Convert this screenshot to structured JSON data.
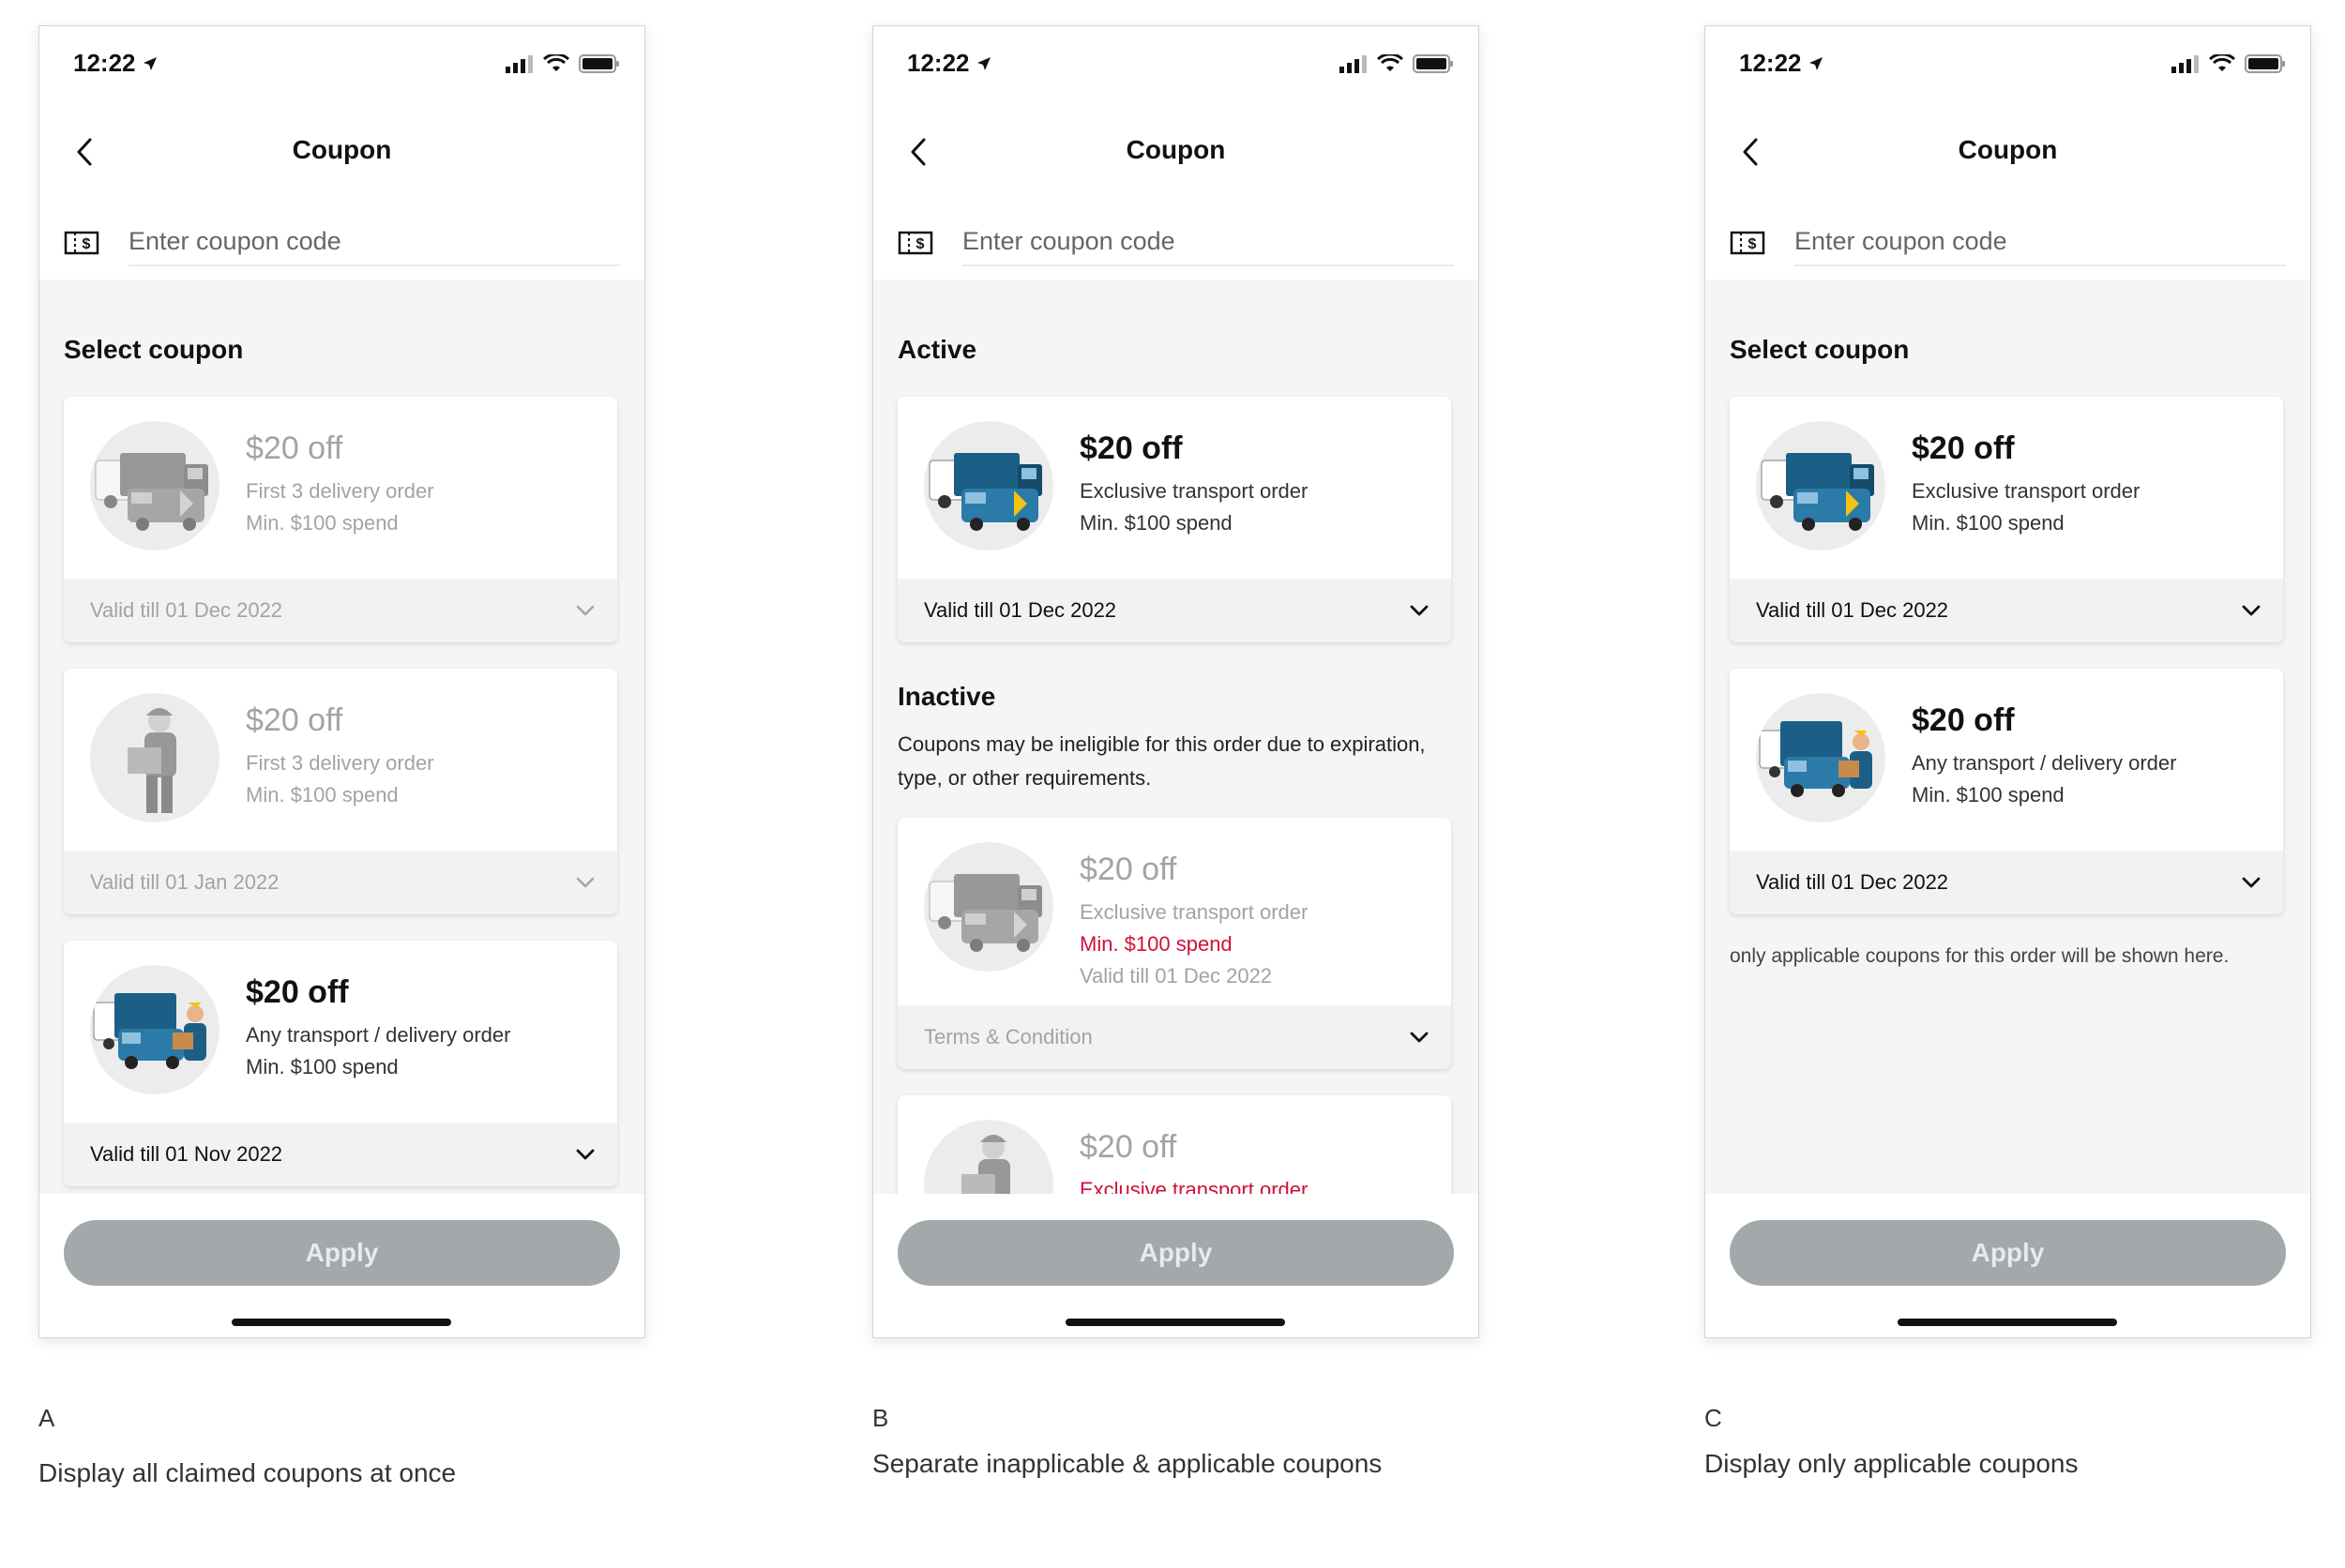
{
  "status": {
    "time": "12:22"
  },
  "common": {
    "screen_title": "Coupon",
    "coupon_placeholder": "Enter coupon code",
    "apply_label": "Apply"
  },
  "colors": {
    "apply_bg": "#a3a8ab",
    "accent_red": "#d0103a",
    "truck_blue": "#1c5f86",
    "highlight_yellow": "#f1c40f"
  },
  "variants": {
    "a": {
      "letter": "A",
      "caption": "Display all claimed coupons at once",
      "section_title": "Select coupon",
      "cards": [
        {
          "title": "$20 off",
          "line1": "First 3 delivery order",
          "line2": "Min. $100 spend",
          "footer": "Valid till 01 Dec 2022",
          "illustration": "truck-icon",
          "state": "inactive"
        },
        {
          "title": "$20 off",
          "line1": "First 3 delivery order",
          "line2": "Min. $100 spend",
          "footer": "Valid till 01 Jan 2022",
          "illustration": "courier-icon",
          "state": "inactive"
        },
        {
          "title": "$20 off",
          "line1": "Any transport / delivery order",
          "line2": "Min. $100 spend",
          "footer": "Valid till 01 Nov 2022",
          "illustration": "truck-courier-icon",
          "state": "active"
        }
      ]
    },
    "b": {
      "letter": "B",
      "caption": "Separate inapplicable & applicable coupons",
      "active_title": "Active",
      "inactive_title": "Inactive",
      "inactive_desc": "Coupons may be ineligible for this order due to expiration, type, or other requirements.",
      "cards": [
        {
          "title": "$20 off",
          "line1": "Exclusive transport order",
          "line2": "Min. $100 spend",
          "footer": "Valid till 01 Dec 2022",
          "illustration": "truck-icon",
          "state": "active"
        },
        {
          "title": "$20 off",
          "line1": "Exclusive transport order",
          "line2": "Min. $100 spend",
          "line3": "Valid till 01 Dec 2022",
          "footer": "Terms & Condition",
          "illustration": "truck-icon",
          "state": "inactive"
        },
        {
          "title": "$20 off",
          "line1": "Exclusive transport order",
          "illustration": "truck-icon",
          "state": "inactive"
        }
      ]
    },
    "c": {
      "letter": "C",
      "caption": "Display only applicable coupons",
      "section_title": "Select coupon",
      "note": "only applicable coupons for this order will be shown here.",
      "cards": [
        {
          "title": "$20 off",
          "line1": "Exclusive transport order",
          "line2": "Min. $100 spend",
          "footer": "Valid till 01 Dec 2022",
          "illustration": "truck-icon",
          "state": "active"
        },
        {
          "title": "$20 off",
          "line1": "Any transport / delivery order",
          "line2": "Min. $100 spend",
          "footer": "Valid till 01 Dec 2022",
          "illustration": "truck-courier-icon",
          "state": "active"
        }
      ]
    }
  }
}
